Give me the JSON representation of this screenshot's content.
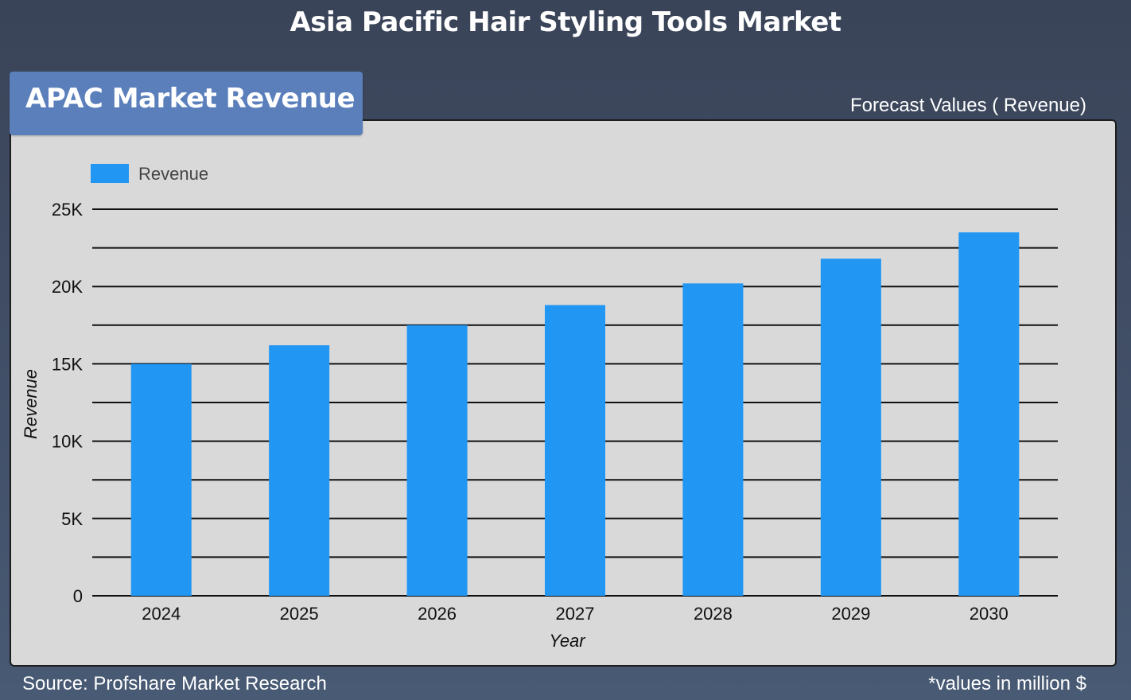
{
  "header": {
    "title": "Asia Pacific Hair Styling Tools Market"
  },
  "section": {
    "tab_label": "APAC Market Revenue",
    "caption": "Forecast Values ( Revenue)"
  },
  "footer": {
    "source": "Source: Profshare Market Research",
    "note": "*values in million $"
  },
  "colors": {
    "bar": "#2196f3",
    "panel": "#d9d9d9",
    "tab": "#5b7fbb",
    "gridline": "#111111"
  },
  "chart_data": {
    "type": "bar",
    "categories": [
      "2024",
      "2025",
      "2026",
      "2027",
      "2028",
      "2029",
      "2030"
    ],
    "series": [
      {
        "name": "Revenue",
        "values": [
          15000,
          16200,
          17500,
          18800,
          20200,
          21800,
          23500
        ]
      }
    ],
    "xlabel": "Year",
    "ylabel": "Revenue",
    "ylim": [
      0,
      25000
    ],
    "yticks": [
      0,
      5000,
      10000,
      15000,
      20000,
      25000
    ],
    "ytick_labels": [
      "0",
      "5K",
      "10K",
      "15K",
      "20K",
      "25K"
    ],
    "grid": true,
    "legend": "top-left"
  }
}
